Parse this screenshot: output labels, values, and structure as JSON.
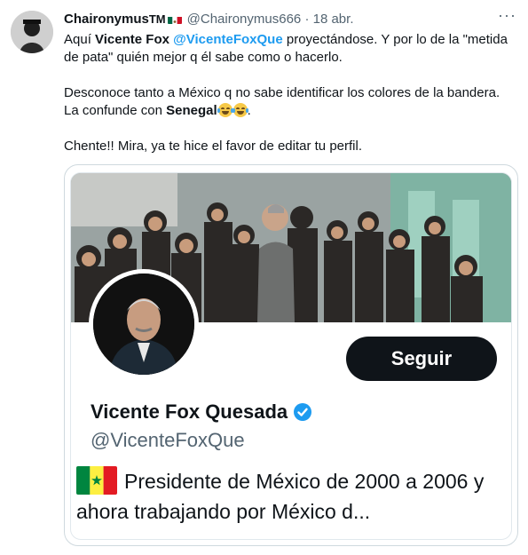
{
  "tweet": {
    "author_name": "Chaironymus",
    "author_tm": "TM",
    "handle": "@Chaironymus666",
    "separator": "·",
    "date": "18 abr.",
    "more_label": "···",
    "text": {
      "p1_a": "Aquí ",
      "p1_b": "Vicente Fox",
      "p1_c": " ",
      "p1_mention": "@VicenteFoxQue",
      "p1_d": " proyectándose. Y por lo de la \"metida de pata\" quién mejor q él sabe como o hacerlo.",
      "p2_a": "Desconoce tanto a México q no sabe identificar los colores de la bandera. La confunde con ",
      "p2_b": "Senegal",
      "p2_c": ".",
      "p3": "Chente!! Mira, ya te hice el favor de editar tu perfil."
    }
  },
  "profile": {
    "follow_label": "Seguir",
    "name": "Vicente Fox Quesada",
    "handle": "@VicenteFoxQue",
    "bio": "Presidente de México de 2000 a 2006 y ahora trabajando por México d..."
  },
  "colors": {
    "link": "#1d9bf0",
    "verified": "#1d9bf0",
    "follow_bg": "#0f1419",
    "muted": "#536471"
  }
}
